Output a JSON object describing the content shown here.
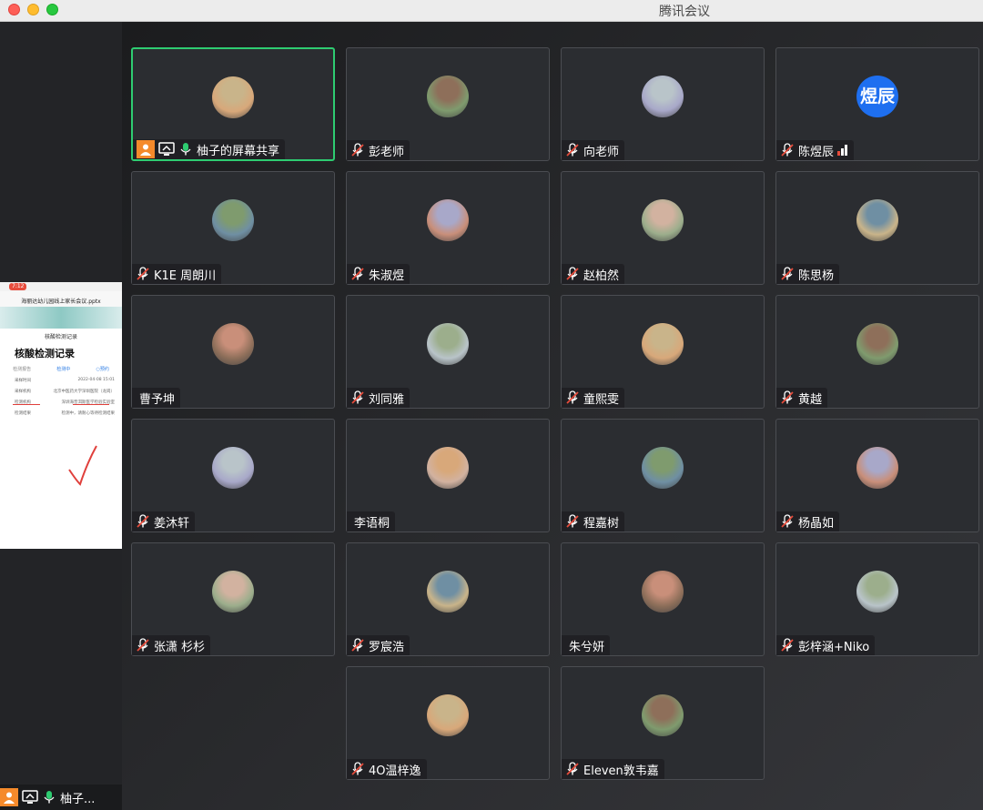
{
  "window": {
    "title": "腾讯会议"
  },
  "colors": {
    "active_border": "#2ecc71",
    "share_icon": "#f58a2b",
    "avatar_text_bg": "#1e6ff0",
    "mic_muted": "#ffffff"
  },
  "self": {
    "name": "柚子..."
  },
  "shared_thumbnail": {
    "clock": "7:12",
    "file_name": "海丽达幼儿园线上家长会议.pptx",
    "page_heading": "核酸检测记录",
    "big_title": "核酸检测记录",
    "tabs": [
      "检测报告",
      "检测中"
    ],
    "badge": "○预约",
    "rows": [
      {
        "k": "采样时间",
        "v": "2022-04-08 15:01"
      },
      {
        "k": "采样机构",
        "v": "北京中医药大学深圳医院（龙岗）"
      },
      {
        "k": "检测机构",
        "v": "深圳海普洱斯医学检验实验室"
      },
      {
        "k": "检测结果",
        "v": "检测中，请耐心等待检测结果"
      }
    ]
  },
  "participants": [
    {
      "name": "柚子的屏幕共享",
      "avatar_icon": "person-photo-icon",
      "muted": false,
      "sharing": true,
      "active": true
    },
    {
      "name": "彭老师",
      "avatar_icon": "person-photo-icon",
      "muted": true
    },
    {
      "name": "向老师",
      "avatar_icon": "person-photo-icon",
      "muted": true
    },
    {
      "name": "陈煜辰",
      "avatar_text": "煜辰",
      "muted": true,
      "signal": true
    },
    {
      "name": "K1E 周朗川",
      "avatar_icon": "person-photo-icon",
      "muted": true
    },
    {
      "name": "朱淑煜",
      "avatar_icon": "cartoon-photo-icon",
      "muted": true
    },
    {
      "name": "赵柏然",
      "avatar_icon": "cat-photo-icon",
      "muted": true
    },
    {
      "name": "陈思杨",
      "avatar_icon": "person-photo-icon",
      "muted": true
    },
    {
      "name": "曹予坤",
      "avatar_icon": "cartoon-photo-icon",
      "muted": false,
      "no_mic": true
    },
    {
      "name": "刘同雅",
      "avatar_icon": "person-photo-icon",
      "muted": true
    },
    {
      "name": "童熙雯",
      "avatar_icon": "drink-photo-icon",
      "muted": true
    },
    {
      "name": "黄越",
      "avatar_icon": "building-photo-icon",
      "muted": true
    },
    {
      "name": "姜沐轩",
      "avatar_icon": "person-photo-icon",
      "muted": true
    },
    {
      "name": "李语桐",
      "avatar_icon": "person-photo-icon",
      "muted": false,
      "no_mic": true
    },
    {
      "name": "程嘉树",
      "avatar_icon": "bear-photo-icon",
      "muted": true
    },
    {
      "name": "杨晶如",
      "avatar_icon": "landscape-photo-icon",
      "muted": true
    },
    {
      "name": "张潇 杉杉",
      "avatar_icon": "flower-photo-icon",
      "muted": true
    },
    {
      "name": "罗宸浩",
      "avatar_icon": "person-photo-icon",
      "muted": true
    },
    {
      "name": "朱兮妍",
      "avatar_icon": "street-photo-icon",
      "muted": false,
      "no_mic": true
    },
    {
      "name": "彭梓涵+Niko",
      "avatar_icon": "person-photo-icon",
      "muted": true
    },
    {
      "name": "4O温梓逸",
      "avatar_icon": "group-photo-icon",
      "muted": true
    },
    {
      "name": "Eleven敦韦嘉",
      "avatar_icon": "person-photo-icon",
      "muted": true
    }
  ]
}
